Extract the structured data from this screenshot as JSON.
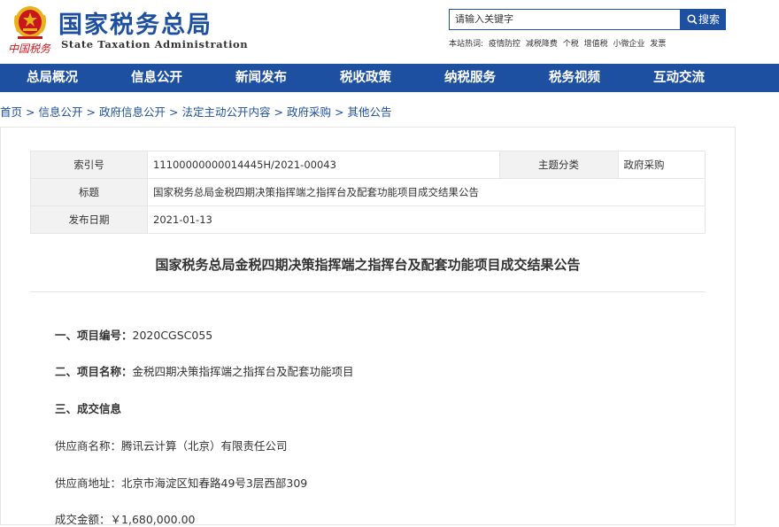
{
  "header": {
    "site_name_cn": "国家税务总局",
    "site_name_en": "State Taxation Administration",
    "emblem_caption": "中国税务"
  },
  "search": {
    "placeholder": "请输入关键字",
    "button_label": "搜索",
    "hot_label": "本站热词:",
    "hot_words": [
      "疫情防控",
      "减税降费",
      "个税",
      "增值税",
      "小微企业",
      "发票"
    ]
  },
  "nav": {
    "items": [
      "总局概况",
      "信息公开",
      "新闻发布",
      "税收政策",
      "纳税服务",
      "税务视频",
      "互动交流"
    ]
  },
  "breadcrumb": {
    "items": [
      "首页",
      "信息公开",
      "政府信息公开",
      "法定主动公开内容",
      "政府采购",
      "其他公告"
    ],
    "separator": ">"
  },
  "meta": {
    "index_label": "索引号",
    "index_value": "11100000000014445H/2021-00043",
    "topic_label": "主题分类",
    "topic_value": "政府采购",
    "title_label": "标题",
    "title_value": "国家税务总局金税四期决策指挥端之指挥台及配套功能项目成交结果公告",
    "date_label": "发布日期",
    "date_value": "2021-01-13"
  },
  "article": {
    "title": "国家税务总局金税四期决策指挥端之指挥台及配套功能项目成交结果公告",
    "section1_label": "一、项目编号：",
    "section1_value": "2020CGSC055",
    "section2_label": "二、项目名称：",
    "section2_value": "金税四期决策指挥端之指挥台及配套功能项目",
    "section3_label": "三、成交信息",
    "supplier_name_label": "供应商名称：",
    "supplier_name_value": "腾讯云计算（北京）有限责任公司",
    "supplier_addr_label": "供应商地址：",
    "supplier_addr_value": "北京市海淀区知春路49号3层西部309",
    "amount_label": "成交金额：",
    "amount_value": "￥1,680,000.00"
  },
  "colors": {
    "brand_blue": "#1e50a2",
    "emblem_red": "#c8161d",
    "emblem_gold": "#e8b21a"
  }
}
